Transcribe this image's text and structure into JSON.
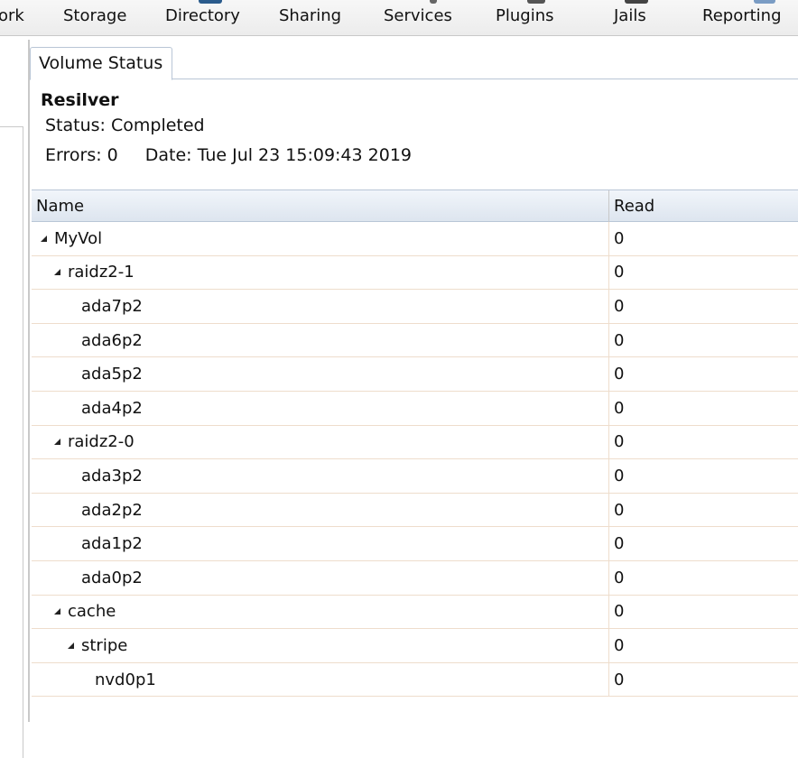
{
  "nav": {
    "items": [
      {
        "label": "ork",
        "name": "nav-network"
      },
      {
        "label": "Storage",
        "name": "nav-storage"
      },
      {
        "label": "Directory",
        "name": "nav-directory"
      },
      {
        "label": "Sharing",
        "name": "nav-sharing"
      },
      {
        "label": "Services",
        "name": "nav-services"
      },
      {
        "label": "Plugins",
        "name": "nav-plugins"
      },
      {
        "label": "Jails",
        "name": "nav-jails"
      },
      {
        "label": "Reporting",
        "name": "nav-reporting"
      }
    ]
  },
  "tab": {
    "label": "Volume Status"
  },
  "resilver": {
    "title": "Resilver",
    "status": "Status: Completed",
    "errors": "Errors: 0",
    "date": "Date: Tue Jul 23 15:09:43 2019"
  },
  "grid": {
    "columns": {
      "name": "Name",
      "read": "Read"
    },
    "rows": [
      {
        "name": "MyVol",
        "read": "0",
        "level": 0,
        "expandable": true
      },
      {
        "name": "raidz2-1",
        "read": "0",
        "level": 1,
        "expandable": true
      },
      {
        "name": "ada7p2",
        "read": "0",
        "level": 2,
        "expandable": false
      },
      {
        "name": "ada6p2",
        "read": "0",
        "level": 2,
        "expandable": false
      },
      {
        "name": "ada5p2",
        "read": "0",
        "level": 2,
        "expandable": false
      },
      {
        "name": "ada4p2",
        "read": "0",
        "level": 2,
        "expandable": false
      },
      {
        "name": "raidz2-0",
        "read": "0",
        "level": 1,
        "expandable": true
      },
      {
        "name": "ada3p2",
        "read": "0",
        "level": 2,
        "expandable": false
      },
      {
        "name": "ada2p2",
        "read": "0",
        "level": 2,
        "expandable": false
      },
      {
        "name": "ada1p2",
        "read": "0",
        "level": 2,
        "expandable": false
      },
      {
        "name": "ada0p2",
        "read": "0",
        "level": 2,
        "expandable": false
      },
      {
        "name": "cache",
        "read": "0",
        "level": 1,
        "expandable": true
      },
      {
        "name": "stripe",
        "read": "0",
        "level": 2,
        "expandable": true
      },
      {
        "name": "nvd0p1",
        "read": "0",
        "level": 3,
        "expandable": false
      }
    ]
  }
}
